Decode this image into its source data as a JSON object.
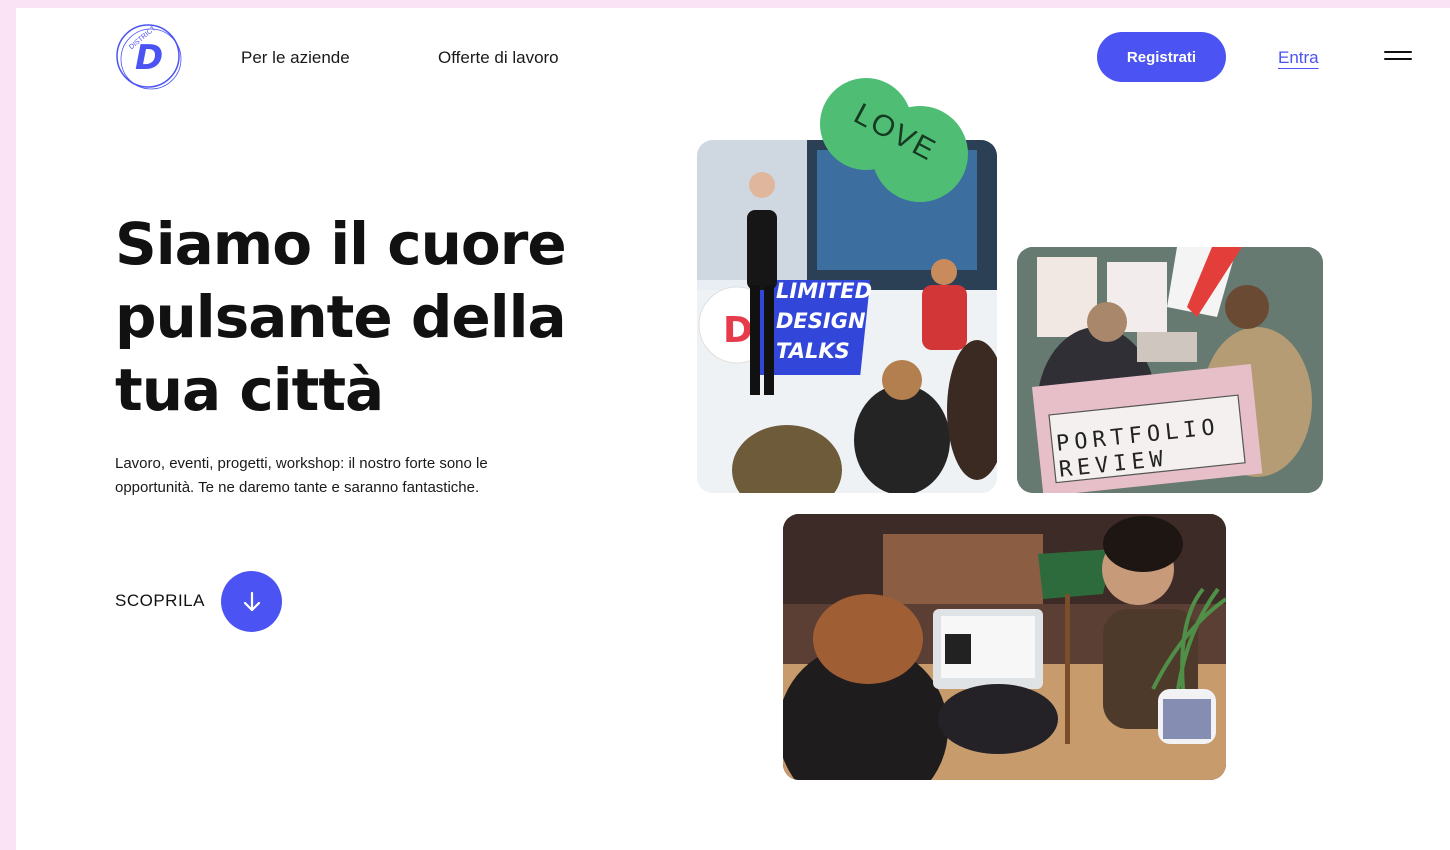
{
  "header": {
    "logo_alt": "District logo",
    "logo_letter": "D",
    "logo_ring_text": "DISTRICT",
    "nav": [
      {
        "label": "Per le aziende"
      },
      {
        "label": "Offerte di lavoro"
      }
    ],
    "register_label": "Registrati",
    "login_label": "Entra"
  },
  "hero": {
    "title_line1": "Siamo il cuore",
    "title_line2": "pulsante della",
    "title_line3": "tua città",
    "subtitle_line1": "Lavoro, eventi, progetti, workshop: il nostro forte sono le",
    "subtitle_line2": "opportunità. Te ne daremo tante e saranno fantastiche.",
    "cta_label": "SCOPRILA"
  },
  "gallery": {
    "sticker_text": "LOVE",
    "talk_banner": [
      "LIMITED",
      "DESIGN",
      "TALKS"
    ],
    "portfolio_sign": "PORTFOLIO\nREVIEW",
    "photo_labels": [
      "design talk photo",
      "portfolio review photo",
      "workshop photo"
    ]
  },
  "colors": {
    "accent": "#4b53f2",
    "background_frame": "#fbe3f6",
    "sticker_green": "#4fbe74"
  }
}
